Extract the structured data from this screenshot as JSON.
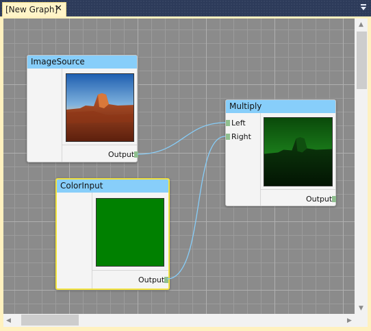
{
  "tab": {
    "title": "[New Graph]",
    "close_glyph": "✕"
  },
  "nodes": {
    "image_source": {
      "title": "ImageSource",
      "output_label": "Output",
      "preview": "desert-butte-photo"
    },
    "color_input": {
      "title": "ColorInput",
      "output_label": "Output",
      "color": "#008000"
    },
    "multiply": {
      "title": "Multiply",
      "left_label": "Left",
      "right_label": "Right",
      "output_label": "Output",
      "preview": "green-tinted-butte"
    }
  },
  "colors": {
    "wire": "#87cefa",
    "port": "#8fbf8f",
    "header": "#87cefa",
    "selection": "#f2e23c"
  },
  "icons": {
    "scroll_up": "▲",
    "scroll_down": "▼",
    "scroll_left": "◀",
    "scroll_right": "▶",
    "window_menu": "chevron-down-icon"
  }
}
